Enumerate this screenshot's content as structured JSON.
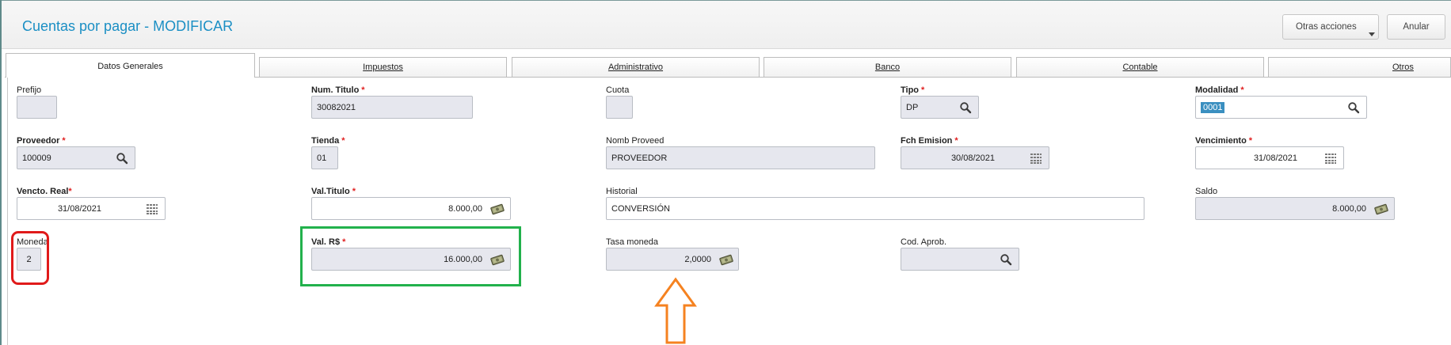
{
  "header": {
    "title": "Cuentas por pagar - MODIFICAR",
    "otras_acciones": "Otras acciones",
    "anular": "Anular"
  },
  "tabs": [
    {
      "label": "Datos Generales",
      "active": true
    },
    {
      "label": "Impuestos"
    },
    {
      "label": "Administrativo"
    },
    {
      "label": "Banco"
    },
    {
      "label": "Contable"
    },
    {
      "label": "Otros"
    }
  ],
  "fields": {
    "prefijo": {
      "label": "Prefijo",
      "value": ""
    },
    "num_titulo": {
      "label": "Num. Titulo",
      "value": "30082021"
    },
    "cuota": {
      "label": "Cuota",
      "value": ""
    },
    "tipo": {
      "label": "Tipo",
      "value": "DP"
    },
    "modalidad": {
      "label": "Modalidad",
      "value": "0001"
    },
    "proveedor": {
      "label": "Proveedor",
      "value": "100009"
    },
    "tienda": {
      "label": "Tienda",
      "value": "01"
    },
    "nomb_proveed": {
      "label": "Nomb Proveed",
      "value": "PROVEEDOR"
    },
    "fch_emision": {
      "label": "Fch Emision",
      "value": "30/08/2021"
    },
    "vencimiento": {
      "label": "Vencimiento",
      "value": "31/08/2021"
    },
    "vencto_real": {
      "label": "Vencto. Real",
      "value": "31/08/2021"
    },
    "val_titulo": {
      "label": "Val.Titulo",
      "value": "8.000,00"
    },
    "historial": {
      "label": "Historial",
      "value": "CONVERSIÓN"
    },
    "saldo": {
      "label": "Saldo",
      "value": "8.000,00"
    },
    "moneda": {
      "label": "Moneda",
      "value": "2"
    },
    "val_rs": {
      "label": "Val. R$",
      "value": "16.000,00"
    },
    "tasa_moneda": {
      "label": "Tasa moneda",
      "value": "2,0000"
    },
    "cod_aprob": {
      "label": "Cod. Aprob.",
      "value": ""
    }
  },
  "required_mark": "*",
  "icons": {
    "lookup": "search-icon",
    "date": "calendar-icon",
    "amount": "money-icon"
  },
  "annotations": {
    "red_box_target": "moneda",
    "green_box_target": "val_rs",
    "arrow_target": "tasa_moneda",
    "colors": {
      "red": "#e01a1a",
      "green": "#22b14c",
      "orange": "#f58220"
    }
  },
  "colors": {
    "title": "#1b8fc4",
    "field_bg": "#e6e7ee",
    "selection": "#3a8fc0"
  }
}
